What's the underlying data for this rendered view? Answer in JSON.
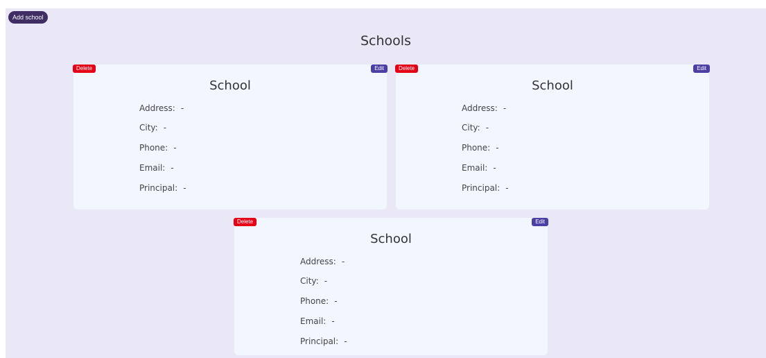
{
  "header": {
    "add_button": "Add school",
    "title": "Schools"
  },
  "cards": [
    {
      "title": "School",
      "delete_label": "Delete",
      "edit_label": "Edit",
      "fields": [
        {
          "label": "Address:",
          "value": "-"
        },
        {
          "label": "City:",
          "value": "-"
        },
        {
          "label": "Phone:",
          "value": "-"
        },
        {
          "label": "Email:",
          "value": "-"
        },
        {
          "label": "Principal:",
          "value": "-"
        }
      ]
    },
    {
      "title": "School",
      "delete_label": "Delete",
      "edit_label": "Edit",
      "fields": [
        {
          "label": "Address:",
          "value": "-"
        },
        {
          "label": "City:",
          "value": "-"
        },
        {
          "label": "Phone:",
          "value": "-"
        },
        {
          "label": "Email:",
          "value": "-"
        },
        {
          "label": "Principal:",
          "value": "-"
        }
      ]
    },
    {
      "title": "School",
      "delete_label": "Delete",
      "edit_label": "Edit",
      "fields": [
        {
          "label": "Address:",
          "value": "-"
        },
        {
          "label": "City:",
          "value": "-"
        },
        {
          "label": "Phone:",
          "value": "-"
        },
        {
          "label": "Email:",
          "value": "-"
        },
        {
          "label": "Principal:",
          "value": "-"
        }
      ]
    }
  ],
  "colors": {
    "background": "#eae8f6",
    "card": "#f2f7ff",
    "add_button": "#3f2d63",
    "delete_button": "#e60016",
    "edit_button": "#4b3fa6"
  }
}
